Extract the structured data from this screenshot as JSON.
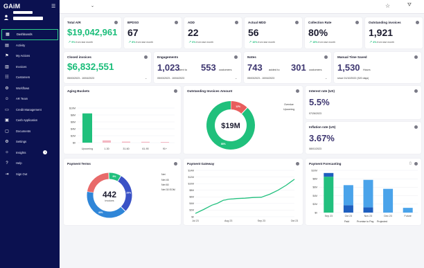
{
  "app": {
    "logo": "GAiM"
  },
  "sidebar": {
    "items": [
      {
        "label": "Dashboards",
        "icon": "▦",
        "active": true
      },
      {
        "label": "Activity",
        "icon": "▤"
      },
      {
        "label": "My Actions",
        "icon": "⚑"
      },
      {
        "label": "Invoices",
        "icon": "▥"
      },
      {
        "label": "Customers",
        "icon": "☷"
      },
      {
        "label": "Workflows",
        "icon": "⚙"
      },
      {
        "label": "AR Team",
        "icon": "☺"
      },
      {
        "label": "Credit Management",
        "icon": "▭"
      },
      {
        "label": "Cash Application",
        "icon": "▣"
      },
      {
        "label": "Documents",
        "icon": "▢"
      },
      {
        "label": "Settings",
        "icon": "⚙"
      },
      {
        "label": "Insights",
        "icon": "☼",
        "badge": "i"
      },
      {
        "label": "Help",
        "icon": "?"
      },
      {
        "label": "Sign Out",
        "icon": "⇥"
      }
    ]
  },
  "kpis": [
    {
      "title": "Total A/R",
      "value": "$19,042,961",
      "pct": "9%",
      "trend": "from last month",
      "green": true
    },
    {
      "title": "BPDSO",
      "value": "67",
      "pct": "8%",
      "trend": "from last month"
    },
    {
      "title": "ADD",
      "value": "22",
      "pct": "6%",
      "trend": "from last month"
    },
    {
      "title": "Actual MDD",
      "value": "56",
      "pct": "10%",
      "trend": "from last month"
    },
    {
      "title": "Collection Rate",
      "value": "80%",
      "pct": "15%",
      "trend": "from last month"
    },
    {
      "title": "Outstanding invoices",
      "value": "1,921",
      "pct": "4%",
      "trend": "from last month"
    }
  ],
  "closed": {
    "title": "Closed invoices",
    "value": "$6,832,551",
    "range": "05/03/2023 - 10/04/2023"
  },
  "engagements": {
    "title": "Engagements",
    "v1": "1,023",
    "l1": "sent to",
    "v2": "553",
    "l2": "customers",
    "range": "05/03/2023 - 10/04/2023"
  },
  "notes": {
    "title": "Notes",
    "v1": "743",
    "l1": "added to",
    "v2": "301",
    "l2": "customers",
    "range": "05/03/2023 - 10/04/2023"
  },
  "manual": {
    "title": "Manual Time Saved",
    "value": "1,530",
    "unit": "Hours",
    "since": "since 01/10/2022 (520 days)"
  },
  "interest": {
    "title": "Interest rate (US)",
    "value": "5.5%",
    "date": "07/26/2023"
  },
  "inflation": {
    "title": "Inflation rate (US)",
    "value": "3.67%",
    "date": "08/01/2023"
  },
  "aging": {
    "title": "Aging Buckets",
    "ticks": [
      "$0",
      "$2M",
      "$4M",
      "$6M",
      "$8M",
      "$10M"
    ],
    "categories": [
      "Upcoming",
      "1-30",
      "31-60",
      "61-90",
      "91+"
    ]
  },
  "outstanding": {
    "title": "Outstanding Invoices Amount",
    "center": "$19M",
    "legend": [
      "Overdue",
      "Upcoming"
    ],
    "labels": [
      "12%",
      "88%"
    ]
  },
  "terms": {
    "title": "Payment Terms",
    "count": "442",
    "unit": "Invoices",
    "legend": [
      "Net",
      "Net 45",
      "Net 60",
      "Net 30 EOM"
    ],
    "labels": [
      "9%",
      "29%",
      "22%",
      "40%"
    ]
  },
  "gateway": {
    "title": "Payment Gateway",
    "ticks": [
      "$0",
      "$2M",
      "$4M",
      "$6M",
      "$8M",
      "$10M",
      "$12M",
      "$14M"
    ],
    "categories": [
      "Jul 23",
      "Aug 23",
      "Sep 23",
      "Oct 23"
    ]
  },
  "forecast": {
    "title": "Payment Forecasting",
    "ticks": [
      "$0",
      "$2M",
      "$4M",
      "$6M",
      "$8M",
      "$10M"
    ],
    "categories": [
      "Sep 23",
      "Oct 23",
      "Nov 23",
      "Dec 23",
      "Future"
    ],
    "legend": [
      "Paid",
      "Promise to Pay",
      "Projected"
    ]
  },
  "chart_data": [
    {
      "type": "bar",
      "title": "Aging Buckets",
      "categories": [
        "Upcoming",
        "1-30",
        "31-60",
        "61-90",
        "91+"
      ],
      "series": [
        {
          "name": "Upcoming",
          "values": [
            16.9,
            0,
            0,
            0,
            0
          ]
        },
        {
          "values": [
            0,
            1.3,
            0.6,
            0.5,
            0.4
          ]
        }
      ],
      "ylim": [
        0,
        20
      ]
    },
    {
      "type": "pie",
      "title": "Outstanding Invoices Amount",
      "categories": [
        "Overdue",
        "Upcoming"
      ],
      "values": [
        12,
        88
      ]
    },
    {
      "type": "pie",
      "title": "Payment Terms",
      "categories": [
        "Net",
        "Net 45",
        "Net 60",
        "Net 30 EOM"
      ],
      "values": [
        22,
        9,
        29,
        40
      ]
    },
    {
      "type": "line",
      "title": "Payment Gateway",
      "categories": [
        "Jul 23",
        "Aug 23",
        "Sep 23",
        "Oct 23"
      ],
      "x": [
        0,
        0.25,
        0.5,
        0.65,
        0.75,
        0.85,
        0.92,
        1.0,
        1.15,
        1.25,
        1.5,
        1.75,
        2.0,
        2.25,
        2.5,
        2.75,
        2.9,
        3.0
      ],
      "values": [
        1.0,
        2.2,
        3.5,
        4.0,
        4.5,
        5.0,
        5.1,
        5.3,
        5.4,
        5.5,
        5.6,
        5.8,
        5.9,
        6.8,
        8.0,
        9.5,
        10.6,
        11.3
      ],
      "ylim": [
        0,
        14
      ]
    },
    {
      "type": "bar",
      "title": "Payment Forecasting",
      "categories": [
        "Sep 23",
        "Oct 23",
        "Nov 23",
        "Dec 23",
        "Future"
      ],
      "series": [
        {
          "name": "Paid",
          "values": [
            6.8,
            0,
            0,
            0,
            0
          ]
        },
        {
          "name": "Promise to Pay",
          "values": [
            0.7,
            1.4,
            1.0,
            0,
            0
          ]
        },
        {
          "name": "Projected",
          "values": [
            0,
            3.8,
            5.2,
            4.5,
            0.9
          ]
        }
      ],
      "ylim": [
        0,
        8
      ]
    }
  ]
}
